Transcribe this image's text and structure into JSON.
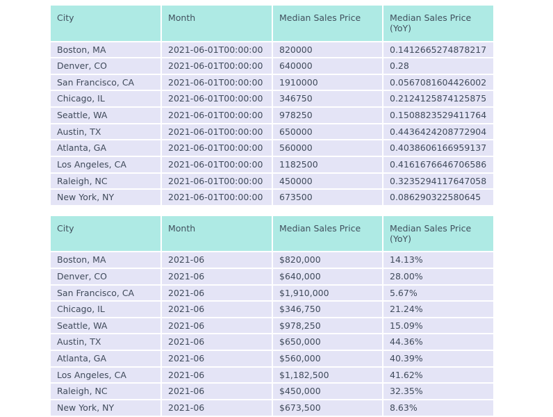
{
  "document": {
    "kind": "two-stacked-data-tables",
    "colors": {
      "page_background": "#ffffff",
      "header_background": "#aeeae4",
      "row_background": "#e4e4f6",
      "grid_line": "#ffffff",
      "text": "#3f4a5a"
    }
  },
  "tables": [
    {
      "name": "raw-values-table",
      "columns": [
        "City",
        "Month",
        "Median Sales Price",
        "Median Sales Price (YoY)"
      ],
      "rows": [
        [
          "Boston, MA",
          "2021-06-01T00:00:00",
          "820000",
          "0.1412665274878217"
        ],
        [
          "Denver, CO",
          "2021-06-01T00:00:00",
          "640000",
          "0.28"
        ],
        [
          "San Francisco, CA",
          "2021-06-01T00:00:00",
          "1910000",
          "0.0567081604426002"
        ],
        [
          "Chicago, IL",
          "2021-06-01T00:00:00",
          "346750",
          "0.2124125874125875"
        ],
        [
          "Seattle, WA",
          "2021-06-01T00:00:00",
          "978250",
          "0.1508823529411764"
        ],
        [
          "Austin, TX",
          "2021-06-01T00:00:00",
          "650000",
          "0.4436424208772904"
        ],
        [
          "Atlanta, GA",
          "2021-06-01T00:00:00",
          "560000",
          "0.4038606166959137"
        ],
        [
          "Los Angeles, CA",
          "2021-06-01T00:00:00",
          "1182500",
          "0.4161676646706586"
        ],
        [
          "Raleigh, NC",
          "2021-06-01T00:00:00",
          "450000",
          "0.3235294117647058"
        ],
        [
          "New York, NY",
          "2021-06-01T00:00:00",
          "673500",
          "0.086290322580645"
        ]
      ]
    },
    {
      "name": "formatted-values-table",
      "columns": [
        "City",
        "Month",
        "Median Sales Price",
        "Median Sales Price (YoY)"
      ],
      "rows": [
        [
          "Boston, MA",
          "2021-06",
          "$820,000",
          "14.13%"
        ],
        [
          "Denver, CO",
          "2021-06",
          "$640,000",
          "28.00%"
        ],
        [
          "San Francisco, CA",
          "2021-06",
          "$1,910,000",
          "5.67%"
        ],
        [
          "Chicago, IL",
          "2021-06",
          "$346,750",
          "21.24%"
        ],
        [
          "Seattle, WA",
          "2021-06",
          "$978,250",
          "15.09%"
        ],
        [
          "Austin, TX",
          "2021-06",
          "$650,000",
          "44.36%"
        ],
        [
          "Atlanta, GA",
          "2021-06",
          "$560,000",
          "40.39%"
        ],
        [
          "Los Angeles, CA",
          "2021-06",
          "$1,182,500",
          "41.62%"
        ],
        [
          "Raleigh, NC",
          "2021-06",
          "$450,000",
          "32.35%"
        ],
        [
          "New York, NY",
          "2021-06",
          "$673,500",
          "8.63%"
        ]
      ]
    }
  ]
}
